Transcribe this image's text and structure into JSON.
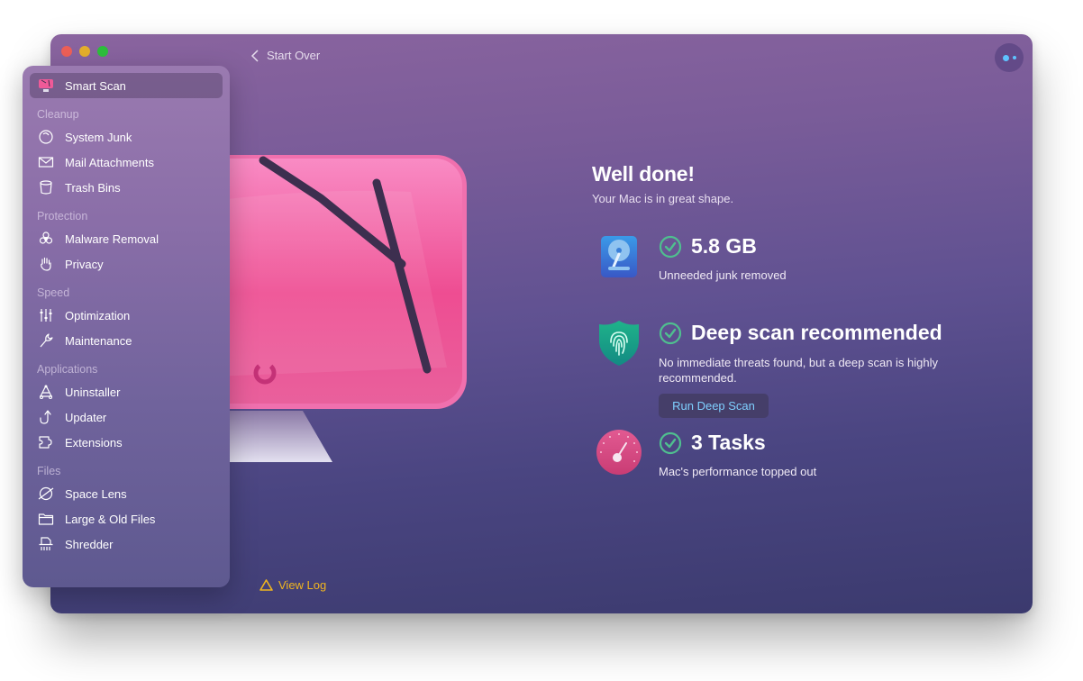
{
  "window": {
    "nav": {
      "back_label": "Start Over"
    },
    "assistant_button": "assistant-icon"
  },
  "sidebar": {
    "active": {
      "label": "Smart Scan",
      "icon": "smart-scan-icon"
    },
    "sections": [
      {
        "heading": "Cleanup",
        "items": [
          {
            "label": "System Junk",
            "icon": "system-junk-icon"
          },
          {
            "label": "Mail Attachments",
            "icon": "mail-icon"
          },
          {
            "label": "Trash Bins",
            "icon": "trash-icon"
          }
        ]
      },
      {
        "heading": "Protection",
        "items": [
          {
            "label": "Malware Removal",
            "icon": "biohazard-icon"
          },
          {
            "label": "Privacy",
            "icon": "hand-icon"
          }
        ]
      },
      {
        "heading": "Speed",
        "items": [
          {
            "label": "Optimization",
            "icon": "sliders-icon"
          },
          {
            "label": "Maintenance",
            "icon": "wrench-icon"
          }
        ]
      },
      {
        "heading": "Applications",
        "items": [
          {
            "label": "Uninstaller",
            "icon": "uninstaller-icon"
          },
          {
            "label": "Updater",
            "icon": "updater-icon"
          },
          {
            "label": "Extensions",
            "icon": "puzzle-icon"
          }
        ]
      },
      {
        "heading": "Files",
        "items": [
          {
            "label": "Space Lens",
            "icon": "planet-icon"
          },
          {
            "label": "Large & Old Files",
            "icon": "folder-icon"
          },
          {
            "label": "Shredder",
            "icon": "shredder-icon"
          }
        ]
      }
    ]
  },
  "results": {
    "title": "Well done!",
    "subtitle": "Your Mac is in great shape.",
    "items": [
      {
        "icon": "hard-drive-icon",
        "headline": "5.8 GB",
        "description": "Unneeded junk removed"
      },
      {
        "icon": "shield-fingerprint-icon",
        "headline": "Deep scan recommended",
        "description": "No immediate threats found, but a deep scan is highly recommended.",
        "action_label": "Run Deep Scan"
      },
      {
        "icon": "speedometer-icon",
        "headline": "3 Tasks",
        "description": "Mac's performance topped out"
      }
    ]
  },
  "footer": {
    "view_log_label": "View Log"
  },
  "colors": {
    "accent_check": "#4fbf8f",
    "warning": "#f0b51f",
    "link_blue": "#7fd0ff",
    "pink": "#ef5a98"
  }
}
